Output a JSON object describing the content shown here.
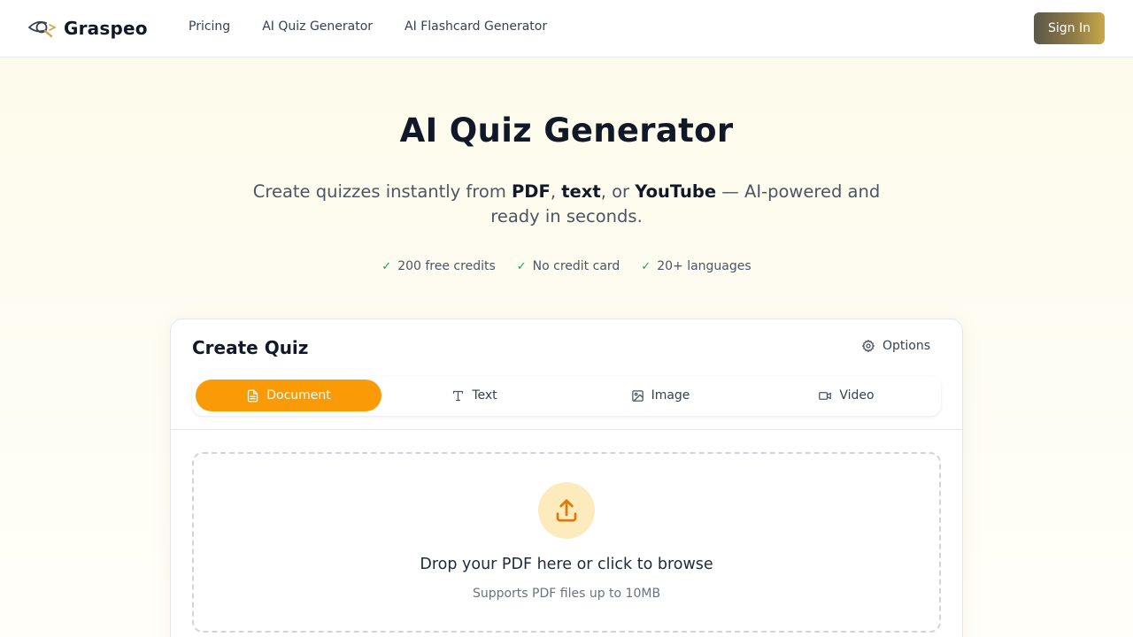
{
  "header": {
    "brand": "Graspeo",
    "nav": [
      "Pricing",
      "AI Quiz Generator",
      "AI Flashcard Generator"
    ],
    "signin_label": "Sign In"
  },
  "hero": {
    "title": "AI Quiz Generator",
    "subtitle_prefix": "Create quizzes instantly from ",
    "subtitle_pdf": "PDF",
    "subtitle_sep1": ", ",
    "subtitle_text": "text",
    "subtitle_sep2": ", or ",
    "subtitle_youtube": "YouTube",
    "subtitle_suffix": " — AI-powered and ready in seconds.",
    "badges": [
      "200 free credits",
      "No credit card",
      "20+ languages"
    ],
    "check_glyph": "✓"
  },
  "card": {
    "title": "Create Quiz",
    "options_label": "Options",
    "tabs": [
      {
        "label": "Document",
        "icon": "document-icon",
        "active": true
      },
      {
        "label": "Text",
        "icon": "text-icon",
        "active": false
      },
      {
        "label": "Image",
        "icon": "image-icon",
        "active": false
      },
      {
        "label": "Video",
        "icon": "video-icon",
        "active": false
      }
    ],
    "dropzone": {
      "title": "Drop your PDF here or click to browse",
      "subtitle": "Supports PDF files up to 10MB",
      "icon": "upload-icon"
    }
  },
  "colors": {
    "accent": "#fb9a07",
    "accent_soft": "#fdebbd",
    "signin_gradient_start": "#5c5749",
    "signin_gradient_end": "#c9a84a",
    "check_green": "#16a34a"
  }
}
